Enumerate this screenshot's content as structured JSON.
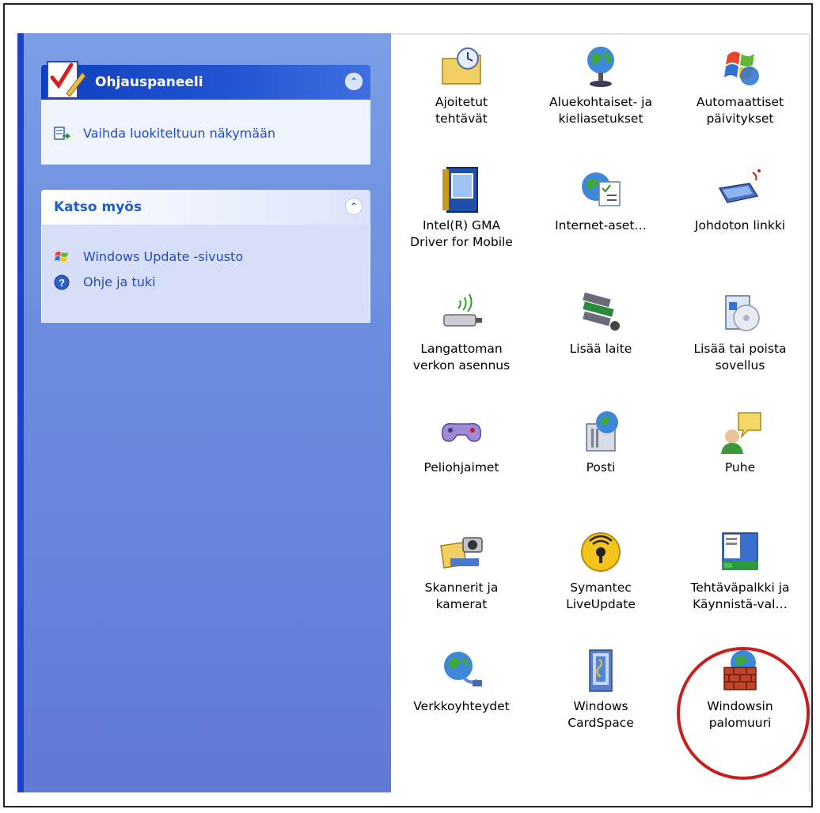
{
  "task_pane": {
    "control_panel": {
      "title": "Ohjauspaneeli",
      "switch_view": "Vaihda luokiteltuun näkymään"
    },
    "see_also": {
      "title": "Katso myös",
      "links": [
        "Windows Update -sivusto",
        "Ohje ja tuki"
      ]
    }
  },
  "items": [
    {
      "label": "Ajoitetut\ntehtävät",
      "icon": "scheduled-tasks-icon"
    },
    {
      "label": "Aluekohtaiset- ja\nkieliasetukset",
      "icon": "regional-language-icon"
    },
    {
      "label": "Automaattiset\npäivitykset",
      "icon": "automatic-updates-icon"
    },
    {
      "label": "Intel(R) GMA\nDriver for Mobile",
      "icon": "intel-gma-icon"
    },
    {
      "label": "Internet-aset…",
      "icon": "internet-options-icon"
    },
    {
      "label": "Johdoton linkki",
      "icon": "wireless-link-icon"
    },
    {
      "label": "Langattoman\nverkon asennus",
      "icon": "wireless-network-setup-icon"
    },
    {
      "label": "Lisää laite",
      "icon": "add-hardware-icon"
    },
    {
      "label": "Lisää tai poista\nsovellus",
      "icon": "add-remove-programs-icon"
    },
    {
      "label": "Peliohjaimet",
      "icon": "game-controllers-icon"
    },
    {
      "label": "Posti",
      "icon": "mail-icon"
    },
    {
      "label": "Puhe",
      "icon": "speech-icon"
    },
    {
      "label": "Skannerit ja\nkamerat",
      "icon": "scanners-cameras-icon"
    },
    {
      "label": "Symantec\nLiveUpdate",
      "icon": "symantec-liveupdate-icon"
    },
    {
      "label": "Tehtäväpalkki ja\nKäynnistä-val…",
      "icon": "taskbar-start-menu-icon"
    },
    {
      "label": "Verkkoyhteydet",
      "icon": "network-connections-icon"
    },
    {
      "label": "Windows\nCardSpace",
      "icon": "cardspace-icon"
    },
    {
      "label": "Windowsin\npalomuuri",
      "icon": "windows-firewall-icon"
    }
  ],
  "colors": {
    "task_pane": "#6b8ddf",
    "header_blue": "#0d3fbf",
    "link_blue": "#214bc2",
    "highlight_red": "#c81e1e"
  }
}
